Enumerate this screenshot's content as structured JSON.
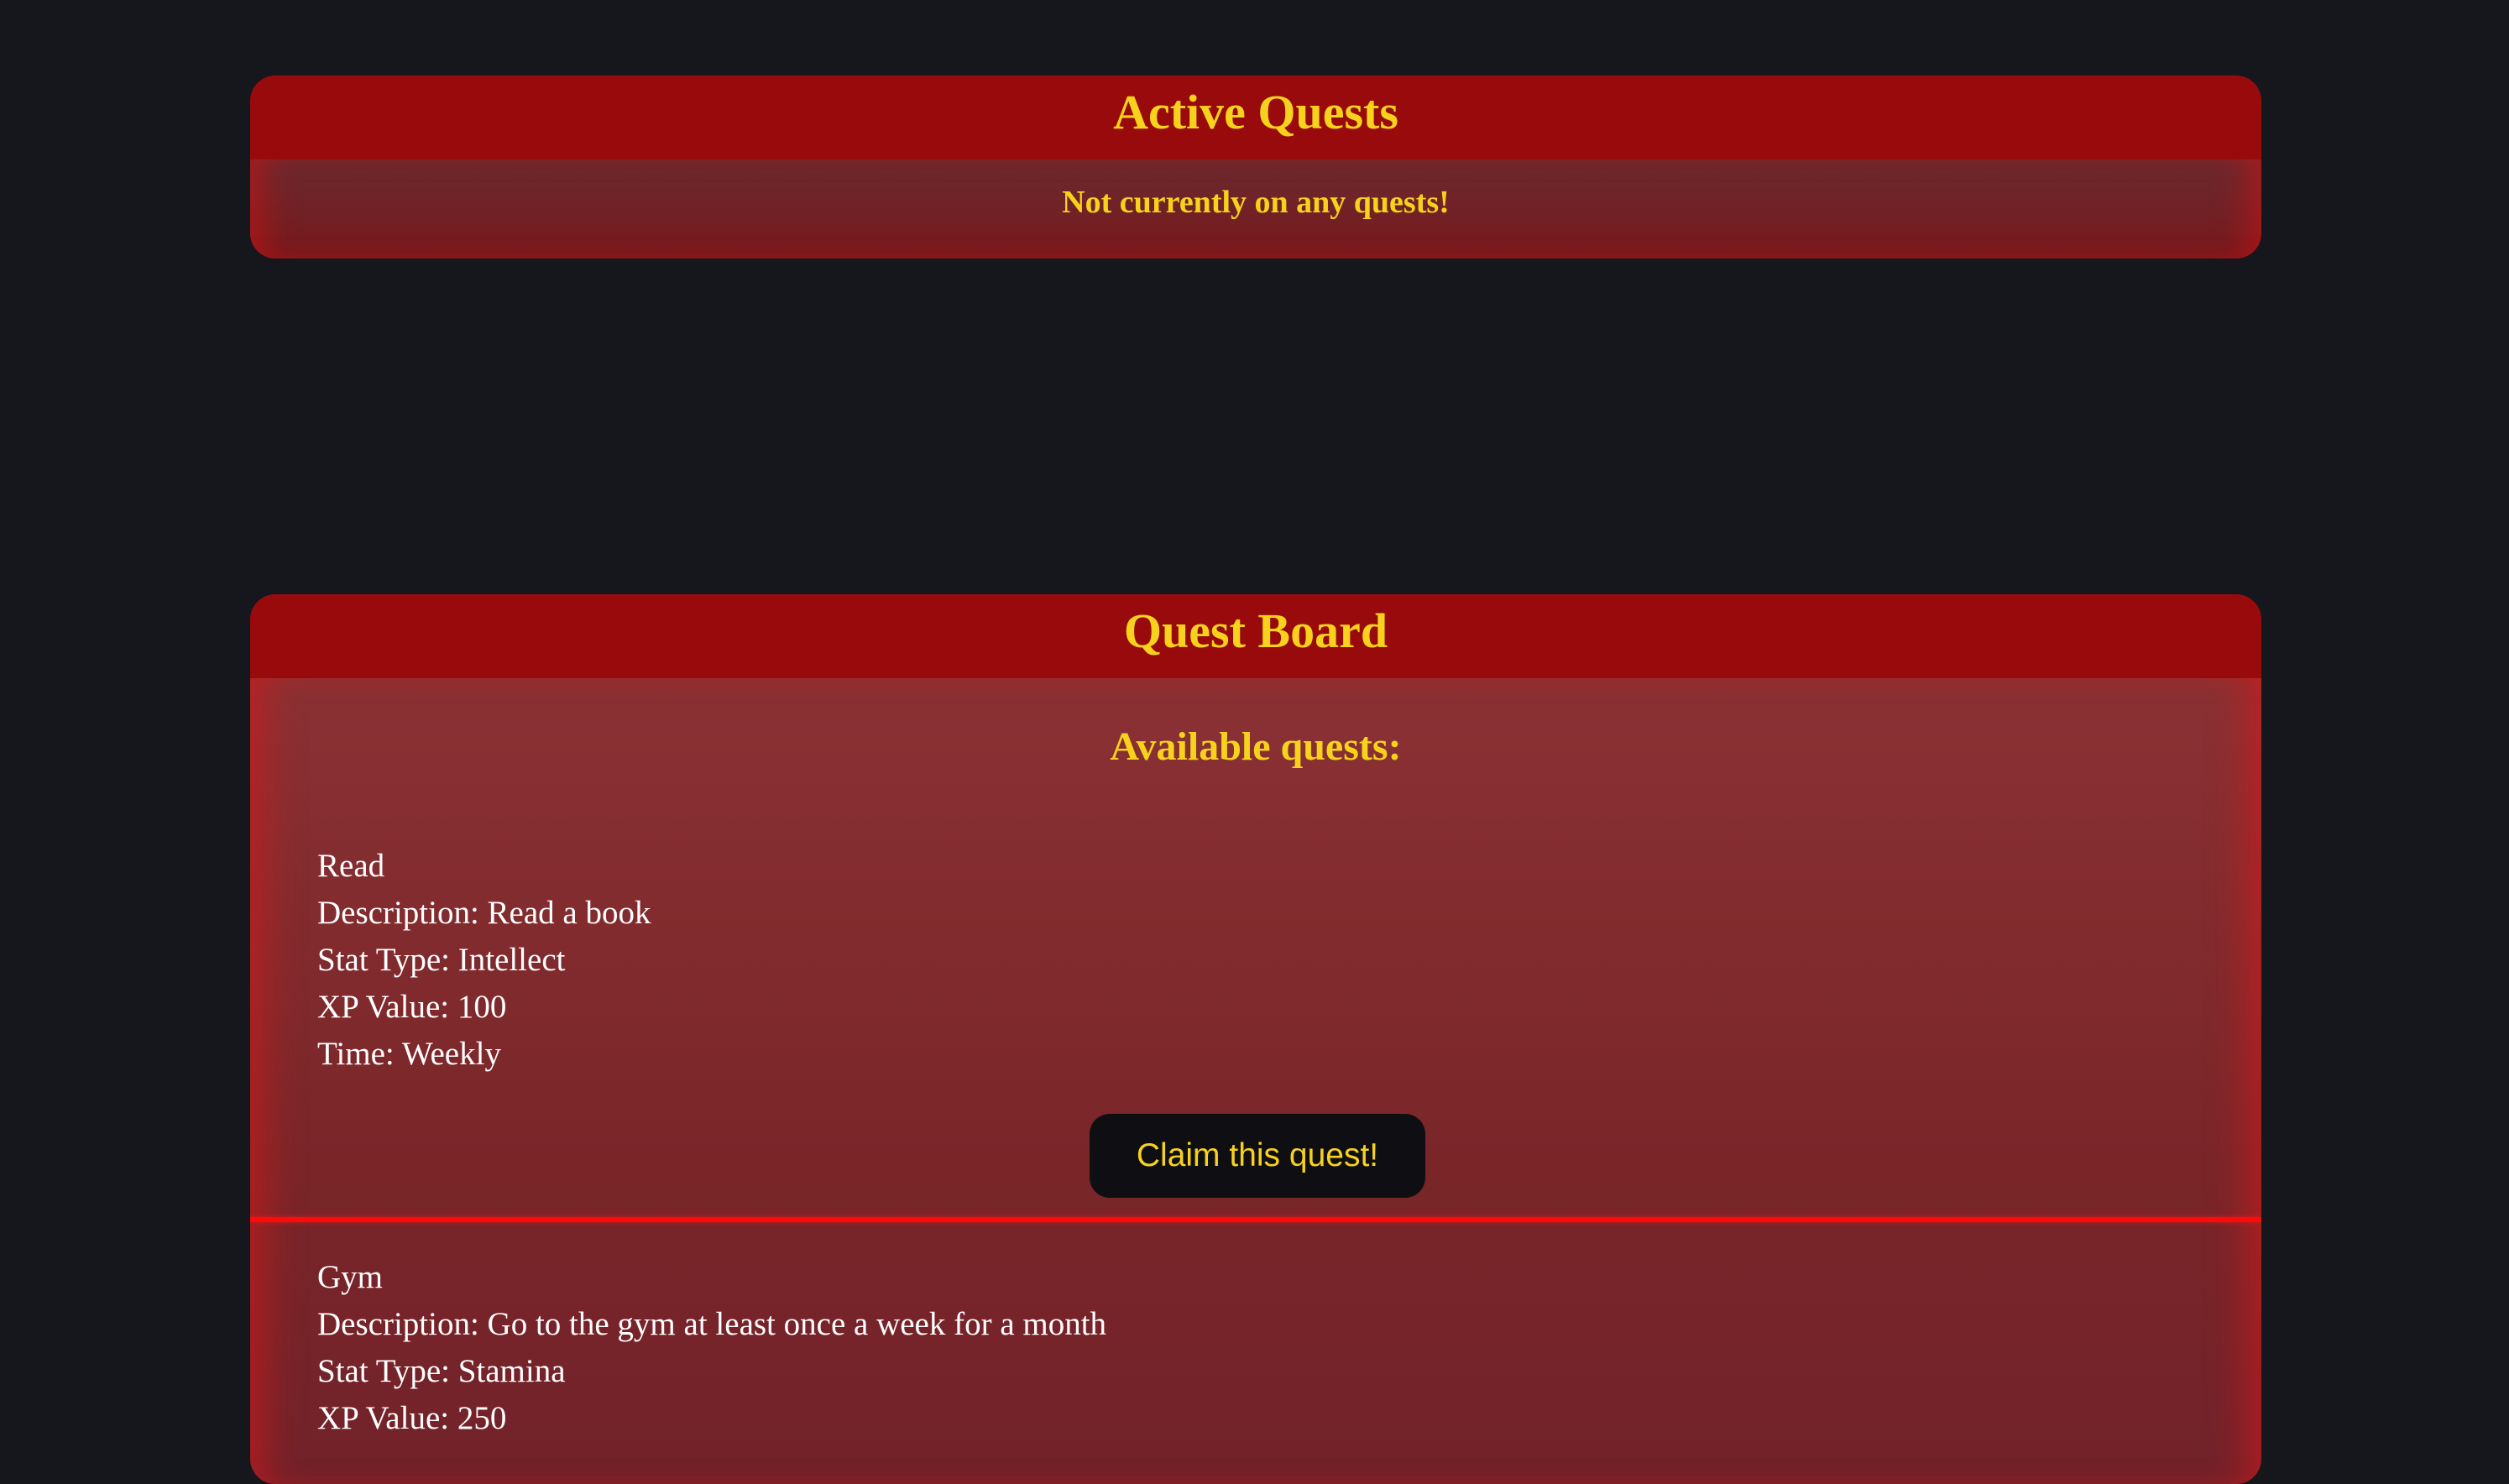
{
  "active_quests": {
    "title": "Active Quests",
    "empty_message": "Not currently on any quests!"
  },
  "quest_board": {
    "title": "Quest Board",
    "available_label": "Available quests:",
    "quests": [
      {
        "name": "Read",
        "description": "Description: Read a book",
        "stat_type": "Stat Type: Intellect",
        "xp_value": "XP Value: 100",
        "time": "Time: Weekly",
        "claim_label": "Claim this quest!"
      },
      {
        "name": "Gym",
        "description": "Description: Go to the gym at least once a week for a month",
        "stat_type": "Stat Type: Stamina",
        "xp_value": "XP Value: 250"
      }
    ]
  },
  "colors": {
    "background": "#16161d",
    "header_red": "#990a0d",
    "title_gold": "#f7d21c",
    "divider_red": "#ff0a0a",
    "button_dark": "#0f0f13"
  }
}
